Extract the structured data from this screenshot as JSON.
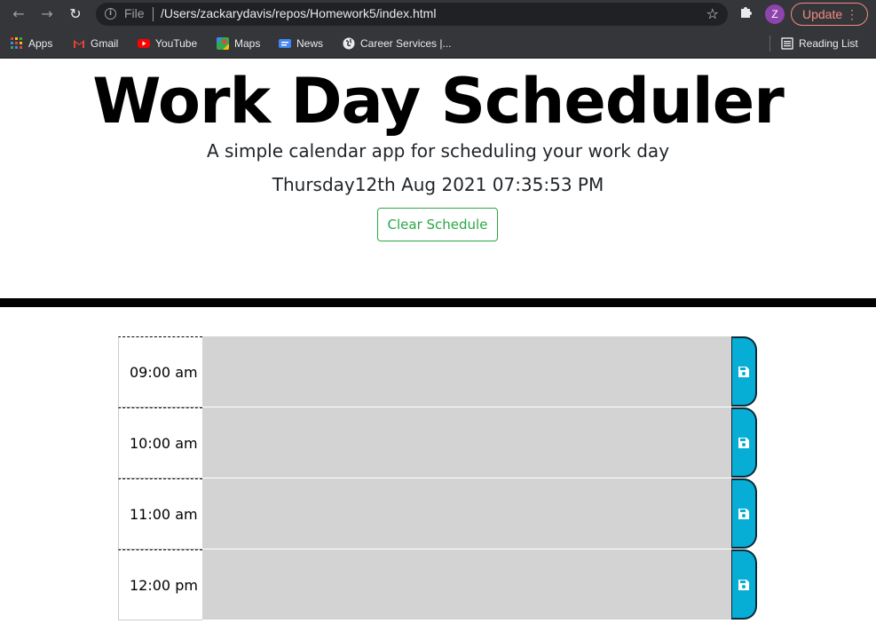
{
  "browser": {
    "file_label": "File",
    "url": "/Users/zackarydavis/repos/Homework5/index.html",
    "avatar_letter": "Z",
    "update_label": "Update",
    "bookmarks": [
      {
        "label": "Apps",
        "icon": "apps-grid-icon"
      },
      {
        "label": "Gmail",
        "icon": "gmail-icon"
      },
      {
        "label": "YouTube",
        "icon": "youtube-icon"
      },
      {
        "label": "Maps",
        "icon": "maps-icon"
      },
      {
        "label": "News",
        "icon": "news-icon"
      },
      {
        "label": "Career Services |...",
        "icon": "globe-icon"
      }
    ],
    "reading_list": "Reading List"
  },
  "header": {
    "title": "Work Day Scheduler",
    "lead": "A simple calendar app for scheduling your work day",
    "current_day": "Thursday12th Aug 2021 07:35:53 PM",
    "clear_label": "Clear Schedule"
  },
  "schedule": {
    "rows": [
      {
        "hour": "09:00 am",
        "text": ""
      },
      {
        "hour": "10:00 am",
        "text": ""
      },
      {
        "hour": "11:00 am",
        "text": ""
      },
      {
        "hour": "12:00 pm",
        "text": ""
      }
    ]
  },
  "colors": {
    "past": "#d3d3d3",
    "save": "#06aed5",
    "clear_button": "#28a745"
  }
}
